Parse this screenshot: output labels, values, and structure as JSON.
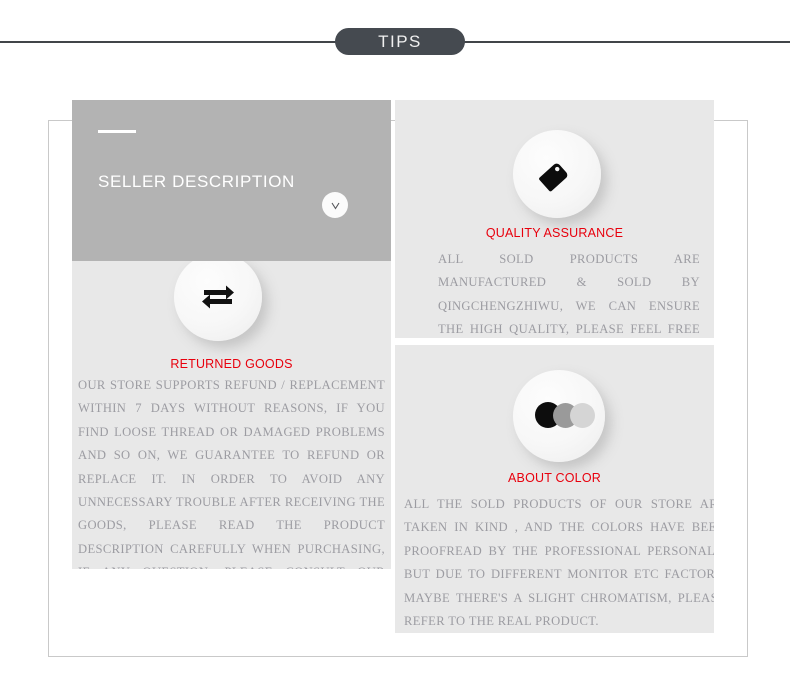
{
  "header": {
    "badge_label": "TIPS"
  },
  "hero": {
    "title": "SELLER DESCRIPTION",
    "toggle_icon": "chevron-down-icon"
  },
  "cards": {
    "quality": {
      "icon": "price-tag-icon",
      "title": "QUALITY ASSURANCE",
      "body": "ALL SOLD PRODUCTS ARE MANUFACTURED & SOLD BY QINGCHENGZHIWU, WE CAN ENSURE THE HIGH QUALITY, PLEASE FEEL FREE TO PURCHASE. THANKS FOR YOUR SUPPORT !"
    },
    "returned": {
      "icon": "repeat-arrows-icon",
      "title": "RETURNED GOODS",
      "body": "OUR STORE SUPPORTS REFUND / REPLACEMENT WITHIN 7 DAYS WITHOUT REASONS, IF YOU FIND LOOSE THREAD OR DAMAGED PROBLEMS AND SO ON, WE GUARANTEE TO REFUND OR REPLACE IT. IN ORDER TO AVOID ANY UNNECESSARY TROUBLE AFTER RECEIVING THE GOODS, PLEASE READ THE PRODUCT DESCRIPTION CAREFULLY WHEN PURCHASING, IF ANY QUESTION, PLEASE CONSULT OUR CUSTOMER SERVICE."
    },
    "color": {
      "icon": "color-swatches-icon",
      "title": "ABOUT COLOR",
      "body": "ALL THE SOLD PRODUCTS OF OUR STORE ARE TAKEN IN KIND , AND THE COLORS HAVE BEEN PROOFREAD BY THE PROFESSIONAL PERSONALS. BUT DUE TO DIFFERENT MONITOR ETC FACTORS, MAYBE THERE'S A SLIGHT CHROMATISM, PLEASE REFER TO THE REAL PRODUCT."
    }
  },
  "colors": {
    "badge_bg": "#454a50",
    "rule": "#414549",
    "hero_bg": "#b3b3b3",
    "card_bg": "#e8e8e8",
    "title_red": "#e8000d",
    "body_text": "#9c9ca2",
    "swatch_dark": "#0d0d0d",
    "swatch_mid": "#9a9a9a",
    "swatch_light": "#d5d5d5"
  }
}
